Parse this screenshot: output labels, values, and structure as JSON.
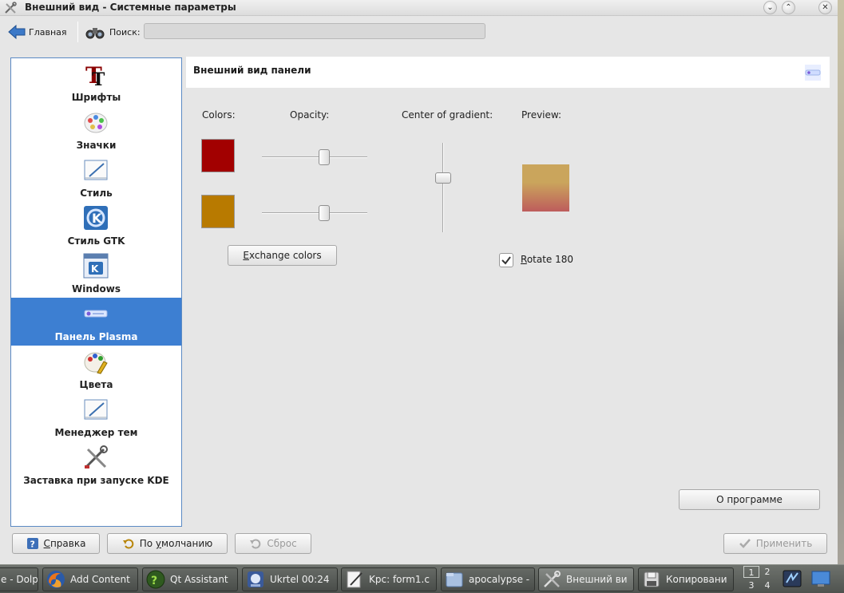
{
  "window": {
    "title": "Внешний вид - Системные параметры"
  },
  "toolbar": {
    "home_label": "Главная",
    "search_label": "Поиск:",
    "search_value": ""
  },
  "sidebar": {
    "items": [
      {
        "label": "Шрифты",
        "icon": "fonts-icon"
      },
      {
        "label": "Значки",
        "icon": "icons-icon"
      },
      {
        "label": "Стиль",
        "icon": "style-icon"
      },
      {
        "label": "Стиль GTK",
        "icon": "gtk-style-icon"
      },
      {
        "label": "Windows",
        "icon": "windows-icon"
      },
      {
        "label": "Панель Plasma",
        "icon": "plasma-panel-icon",
        "active": true
      },
      {
        "label": "Цвета",
        "icon": "colors-icon"
      },
      {
        "label": "Менеджер тем",
        "icon": "theme-manager-icon"
      },
      {
        "label": "Заставка при запуске KDE",
        "icon": "splash-icon"
      }
    ]
  },
  "content": {
    "title": "Внешний вид панели",
    "colors_label": "Colors:",
    "opacity_label": "Opacity:",
    "center_label": "Center of gradient:",
    "preview_label": "Preview:",
    "color1": "#a20000",
    "color2": "#b87a00",
    "opacity1": 0.6,
    "opacity2": 0.6,
    "gradient_center": 0.38,
    "exchange_mnemonic": "E",
    "exchange_rest": "xchange colors",
    "rotate_mnemonic": "R",
    "rotate_rest": "otate 180",
    "rotate_checked": true,
    "about_label": "О программе"
  },
  "buttons": {
    "help_mnemonic": "С",
    "help_rest": "правка",
    "defaults_pre": "По ",
    "defaults_mnemonic": "у",
    "defaults_rest": "молчанию",
    "reset_label": "Сброс",
    "apply_label": "Применить"
  },
  "taskbar": {
    "tasks": [
      {
        "label": "e - Dolp"
      },
      {
        "label": "Add Content"
      },
      {
        "label": "Qt Assistant"
      },
      {
        "label": "Ukrtel 00:24"
      },
      {
        "label": "Kpc: form1.c"
      },
      {
        "label": "apocalypse -"
      },
      {
        "label": "Внешний ви"
      },
      {
        "label": "Копировани"
      }
    ],
    "pager": [
      "1",
      "2",
      "3",
      "4"
    ]
  }
}
